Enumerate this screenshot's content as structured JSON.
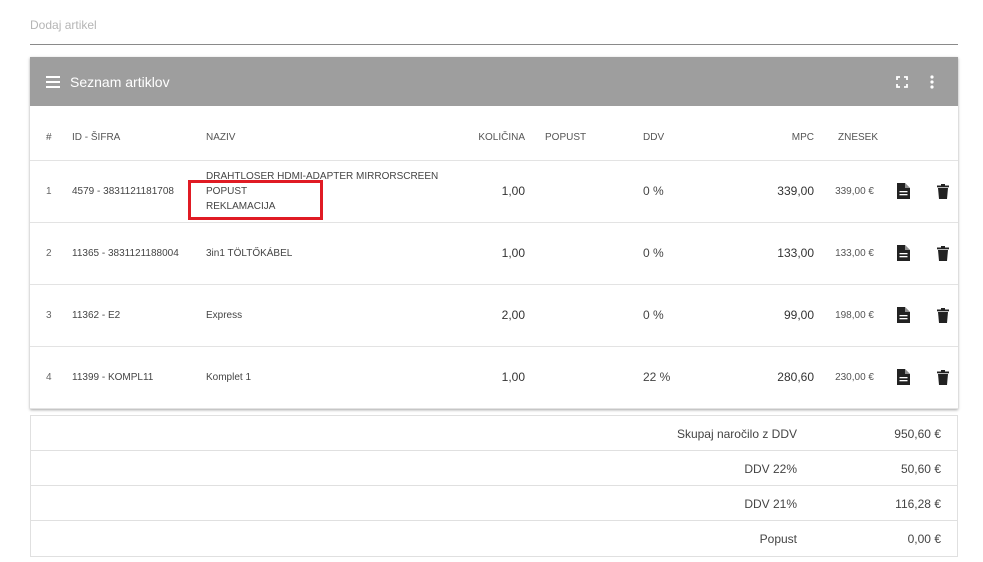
{
  "add_field": {
    "placeholder": "Dodaj artikel"
  },
  "card": {
    "title": "Seznam artiklov",
    "icons": {
      "list": "list-icon",
      "fullscreen": "fullscreen-icon",
      "more": "more-vert-icon"
    }
  },
  "table": {
    "columns": {
      "num": "#",
      "id": "ID - ŠIFRA",
      "name": "NAZIV",
      "qty": "KOLIČINA",
      "discount": "POPUST",
      "ddv": "DDV",
      "mpc": "MPC",
      "total": "ZNESEK"
    },
    "rows": [
      {
        "num": "1",
        "id": "4579 - 3831121181708",
        "name_line1": "DRAHTLOSER HDMI-ADAPTER MIRRORSCREEN",
        "name_line2": "POPUST",
        "name_line3": "REKLAMACIJA",
        "qty": "1,00",
        "discount": "",
        "ddv": "0 %",
        "mpc": "339,00",
        "total": "339,00 €"
      },
      {
        "num": "2",
        "id": "11365 - 3831121188004",
        "name": "3in1 TÖLTŐKÁBEL",
        "qty": "1,00",
        "discount": "",
        "ddv": "0 %",
        "mpc": "133,00",
        "total": "133,00 €"
      },
      {
        "num": "3",
        "id": "11362 - E2",
        "name": "Express",
        "qty": "2,00",
        "discount": "",
        "ddv": "0 %",
        "mpc": "99,00",
        "total": "198,00 €"
      },
      {
        "num": "4",
        "id": "11399 - KOMPL11",
        "name": "Komplet 1",
        "qty": "1,00",
        "discount": "",
        "ddv": "22 %",
        "mpc": "280,60",
        "total": "230,00 €"
      }
    ],
    "row_icons": {
      "doc": "document-icon",
      "delete": "trash-icon"
    }
  },
  "totals": [
    {
      "label": "Skupaj naročilo z DDV",
      "value": "950,60 €"
    },
    {
      "label": "DDV 22%",
      "value": "50,60 €"
    },
    {
      "label": "DDV 21%",
      "value": "116,28 €"
    },
    {
      "label": "Popust",
      "value": "0,00 €"
    }
  ],
  "colors": {
    "header_bg": "#9e9e9e",
    "highlight": "#e01b24"
  }
}
